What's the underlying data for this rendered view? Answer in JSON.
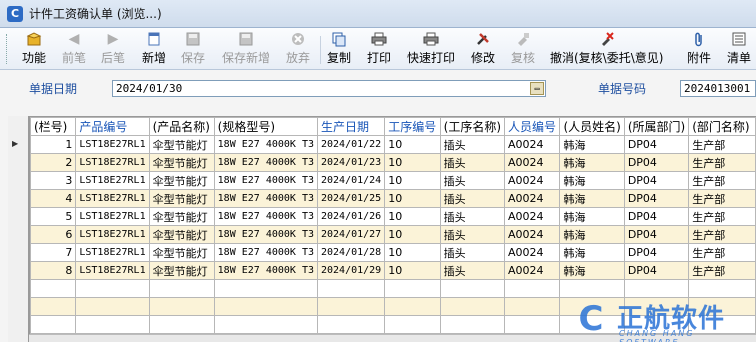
{
  "window": {
    "title": "计件工资确认单 (浏览...)",
    "icon": "app-icon"
  },
  "toolbar": {
    "items": [
      {
        "label": "功能",
        "icon": "box-icon",
        "enabled": true
      },
      {
        "label": "前笔",
        "icon": "arrow-left-icon",
        "enabled": false
      },
      {
        "label": "后笔",
        "icon": "arrow-right-icon",
        "enabled": false
      },
      {
        "label": "新增",
        "icon": "new-doc-icon",
        "enabled": true
      },
      {
        "label": "保存",
        "icon": "save-icon",
        "enabled": false
      },
      {
        "label": "保存新增",
        "icon": "save-new-icon",
        "enabled": false
      },
      {
        "label": "放弃",
        "icon": "cancel-circle-icon",
        "enabled": false
      },
      {
        "label": "复制",
        "icon": "copy-icon",
        "enabled": true
      },
      {
        "label": "打印",
        "icon": "printer-icon",
        "enabled": true
      },
      {
        "label": "快速打印",
        "icon": "quick-print-icon",
        "enabled": true
      },
      {
        "label": "修改",
        "icon": "tools-icon",
        "enabled": true
      },
      {
        "label": "复核",
        "icon": "review-icon",
        "enabled": false
      },
      {
        "label": "撤消(复核\\委托\\意见)",
        "icon": "undo-review-icon",
        "enabled": true
      },
      {
        "label": "附件",
        "icon": "paperclip-icon",
        "enabled": true
      },
      {
        "label": "清单",
        "icon": "list-icon",
        "enabled": true
      }
    ]
  },
  "form": {
    "date_label": "单据日期",
    "date_value": "2024/01/30",
    "number_label": "单据号码",
    "number_value": "2024013001"
  },
  "grid": {
    "columns": [
      {
        "label": "(栏号)",
        "blue": false
      },
      {
        "label": "产品编号",
        "blue": true
      },
      {
        "label": "(产品名称)",
        "blue": false
      },
      {
        "label": "(规格型号)",
        "blue": false
      },
      {
        "label": "生产日期",
        "blue": true
      },
      {
        "label": "工序编号",
        "blue": true
      },
      {
        "label": "(工序名称)",
        "blue": false
      },
      {
        "label": "人员编号",
        "blue": true
      },
      {
        "label": "(人员姓名)",
        "blue": false
      },
      {
        "label": "(所属部门)",
        "blue": false
      },
      {
        "label": "(部门名称)",
        "blue": false
      }
    ],
    "rows": [
      [
        "1",
        "LST18E27RL1",
        "伞型节能灯",
        "18W E27 4000K T3",
        "2024/01/22",
        "10",
        "插头",
        "A0024",
        "韩海",
        "DP04",
        "生产部"
      ],
      [
        "2",
        "LST18E27RL1",
        "伞型节能灯",
        "18W E27 4000K T3",
        "2024/01/23",
        "10",
        "插头",
        "A0024",
        "韩海",
        "DP04",
        "生产部"
      ],
      [
        "3",
        "LST18E27RL1",
        "伞型节能灯",
        "18W E27 4000K T3",
        "2024/01/24",
        "10",
        "插头",
        "A0024",
        "韩海",
        "DP04",
        "生产部"
      ],
      [
        "4",
        "LST18E27RL1",
        "伞型节能灯",
        "18W E27 4000K T3",
        "2024/01/25",
        "10",
        "插头",
        "A0024",
        "韩海",
        "DP04",
        "生产部"
      ],
      [
        "5",
        "LST18E27RL1",
        "伞型节能灯",
        "18W E27 4000K T3",
        "2024/01/26",
        "10",
        "插头",
        "A0024",
        "韩海",
        "DP04",
        "生产部"
      ],
      [
        "6",
        "LST18E27RL1",
        "伞型节能灯",
        "18W E27 4000K T3",
        "2024/01/27",
        "10",
        "插头",
        "A0024",
        "韩海",
        "DP04",
        "生产部"
      ],
      [
        "7",
        "LST18E27RL1",
        "伞型节能灯",
        "18W E27 4000K T3",
        "2024/01/28",
        "10",
        "插头",
        "A0024",
        "韩海",
        "DP04",
        "生产部"
      ],
      [
        "8",
        "LST18E27RL1",
        "伞型节能灯",
        "18W E27 4000K T3",
        "2024/01/29",
        "10",
        "插头",
        "A0024",
        "韩海",
        "DP04",
        "生产部"
      ]
    ],
    "empty_rows": 3
  },
  "watermark": {
    "cn": "正航软件",
    "en": "CHANG HANG SOFTWARE",
    "icon": "chang-hang-logo-icon"
  },
  "colors": {
    "header_blue": "#1a56b8",
    "label_blue": "#1f4fa0",
    "alt_row": "#fbf3d8",
    "logo_blue": "#2a73d6"
  }
}
